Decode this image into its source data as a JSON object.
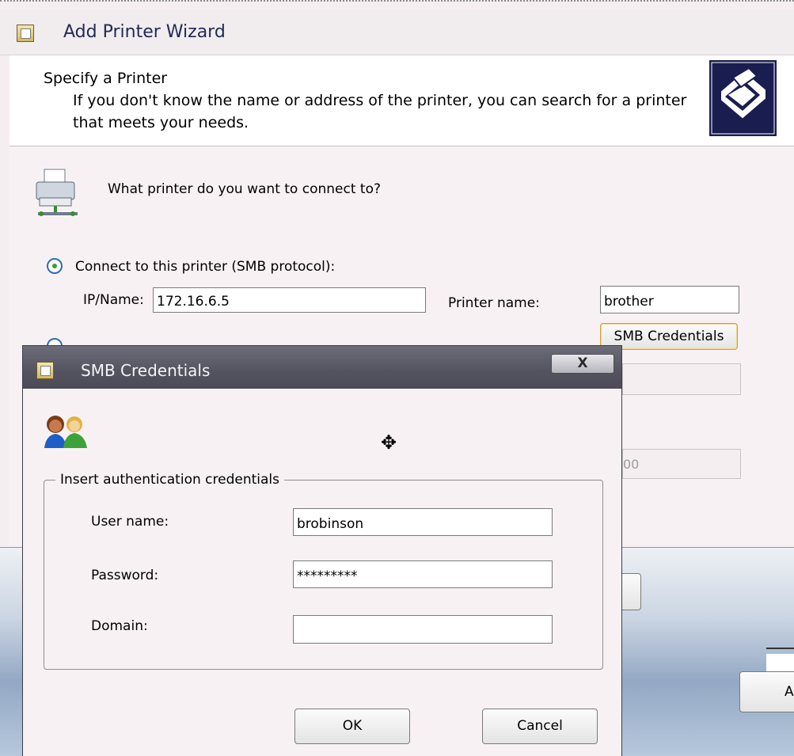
{
  "wizard": {
    "title": "Add Printer Wizard",
    "header_title": "Specify a Printer",
    "header_subtitle": "If you don't know the name or address of the printer, you can search for a printer that meets your needs.",
    "question": "What printer do you want to connect to?",
    "option_smb_label": "Connect to this printer (SMB protocol):",
    "option_smb_checked": true,
    "ip_label": "IP/Name:",
    "ip_value": "172.16.6.5",
    "printer_name_label": "Printer name:",
    "printer_name_value": "brother",
    "smb_credentials_button": "SMB Credentials",
    "hidden_field_partial_value": "00",
    "right_button_partial": "A"
  },
  "dialog": {
    "title": "SMB Credentials",
    "close_label": "X",
    "group_label": "Insert authentication credentials",
    "user_label": "User name:",
    "user_value": "brobinson",
    "password_label": "Password:",
    "password_value": "*********",
    "domain_label": "Domain:",
    "domain_value": "",
    "ok_label": "OK",
    "cancel_label": "Cancel"
  },
  "colors": {
    "dialog_title_bar": "#545360",
    "header_icon_bg": "#1a1d50",
    "radio_dot": "#3d9a33"
  }
}
